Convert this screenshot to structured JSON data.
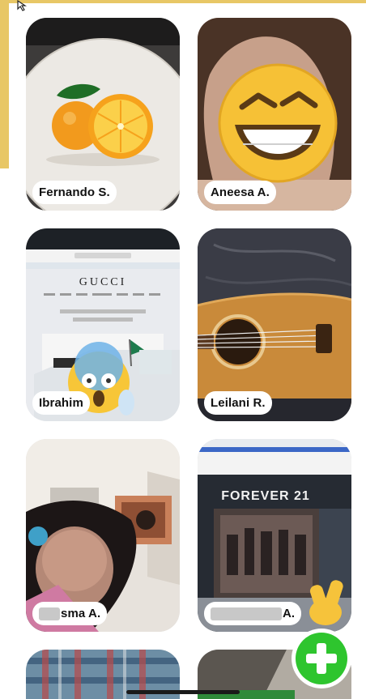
{
  "tiles": [
    {
      "name": "Fernando S."
    },
    {
      "name": "Aneesa A."
    },
    {
      "name": "Ibrahim"
    },
    {
      "name": "Leilani R."
    },
    {
      "name": "sma A."
    },
    {
      "name": "A."
    }
  ],
  "tile_texts": {
    "gucci": "GUCCI",
    "forever21": "FOREVER 21"
  },
  "icons": {
    "fab": "plus-icon",
    "cursor": "cursor-icon"
  },
  "colors": {
    "accent": "#e8c766",
    "fab": "#2ec52e"
  }
}
